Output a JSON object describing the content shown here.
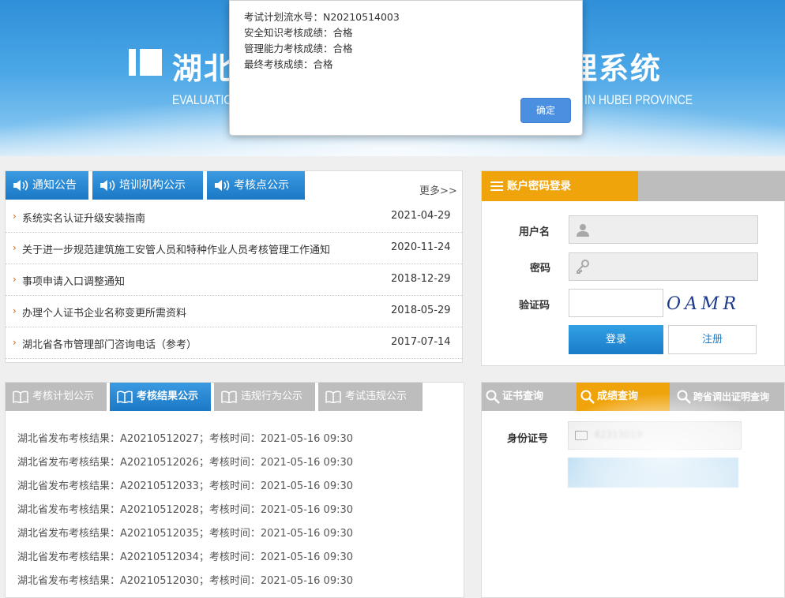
{
  "banner": {
    "title_left": "湖北",
    "title_right": "理系统",
    "subtitle_left": "EVALUATION",
    "subtitle_right": "IN HUBEI PROVINCE"
  },
  "modal": {
    "lines": [
      "考试计划流水号：N20210514003",
      "安全知识考核成绩：合格",
      "管理能力考核成绩：合格",
      "最终考核成绩：合格"
    ],
    "ok_label": "确定"
  },
  "notice": {
    "tabs": [
      "通知公告",
      "培训机构公示",
      "考核点公示"
    ],
    "more_label": "更多>>",
    "items": [
      {
        "title": "系统实名认证升级安装指南",
        "date": "2021-04-29"
      },
      {
        "title": "关于进一步规范建筑施工安管人员和特种作业人员考核管理工作通知",
        "date": "2020-11-24"
      },
      {
        "title": "事项申请入口调整通知",
        "date": "2018-12-29"
      },
      {
        "title": "办理个人证书企业名称变更所需资料",
        "date": "2018-05-29"
      },
      {
        "title": "湖北省各市管理部门咨询电话（参考）",
        "date": "2017-07-14"
      }
    ]
  },
  "login": {
    "tab_label": "账户密码登录",
    "username_label": "用户名",
    "password_label": "密码",
    "captcha_label": "验证码",
    "captcha_text": "OAMR",
    "login_button": "登录",
    "register_button": "注册"
  },
  "results": {
    "tabs": [
      "考核计划公示",
      "考核结果公示",
      "违规行为公示",
      "考试违规公示"
    ],
    "active_tab": 1,
    "rows": [
      "湖北省发布考核结果：A20210512027；考核时间：2021-05-16 09:30",
      "湖北省发布考核结果：A20210512026；考核时间：2021-05-16 09:30",
      "湖北省发布考核结果：A20210512033；考核时间：2021-05-16 09:30",
      "湖北省发布考核结果：A20210512028；考核时间：2021-05-16 09:30",
      "湖北省发布考核结果：A20210512035；考核时间：2021-05-16 09:30",
      "湖北省发布考核结果：A20210512034；考核时间：2021-05-16 09:30",
      "湖北省发布考核结果：A20210512030；考核时间：2021-05-16 09:30"
    ]
  },
  "query": {
    "tabs": [
      "证书查询",
      "成绩查询",
      "跨省调出证明查询"
    ],
    "active_tab": 1,
    "id_label": "身份证号",
    "id_value": "42313019"
  },
  "colors": {
    "blue": "#1a78c6",
    "orange": "#f0a40c",
    "grey_tab": "#bdbdbd"
  }
}
